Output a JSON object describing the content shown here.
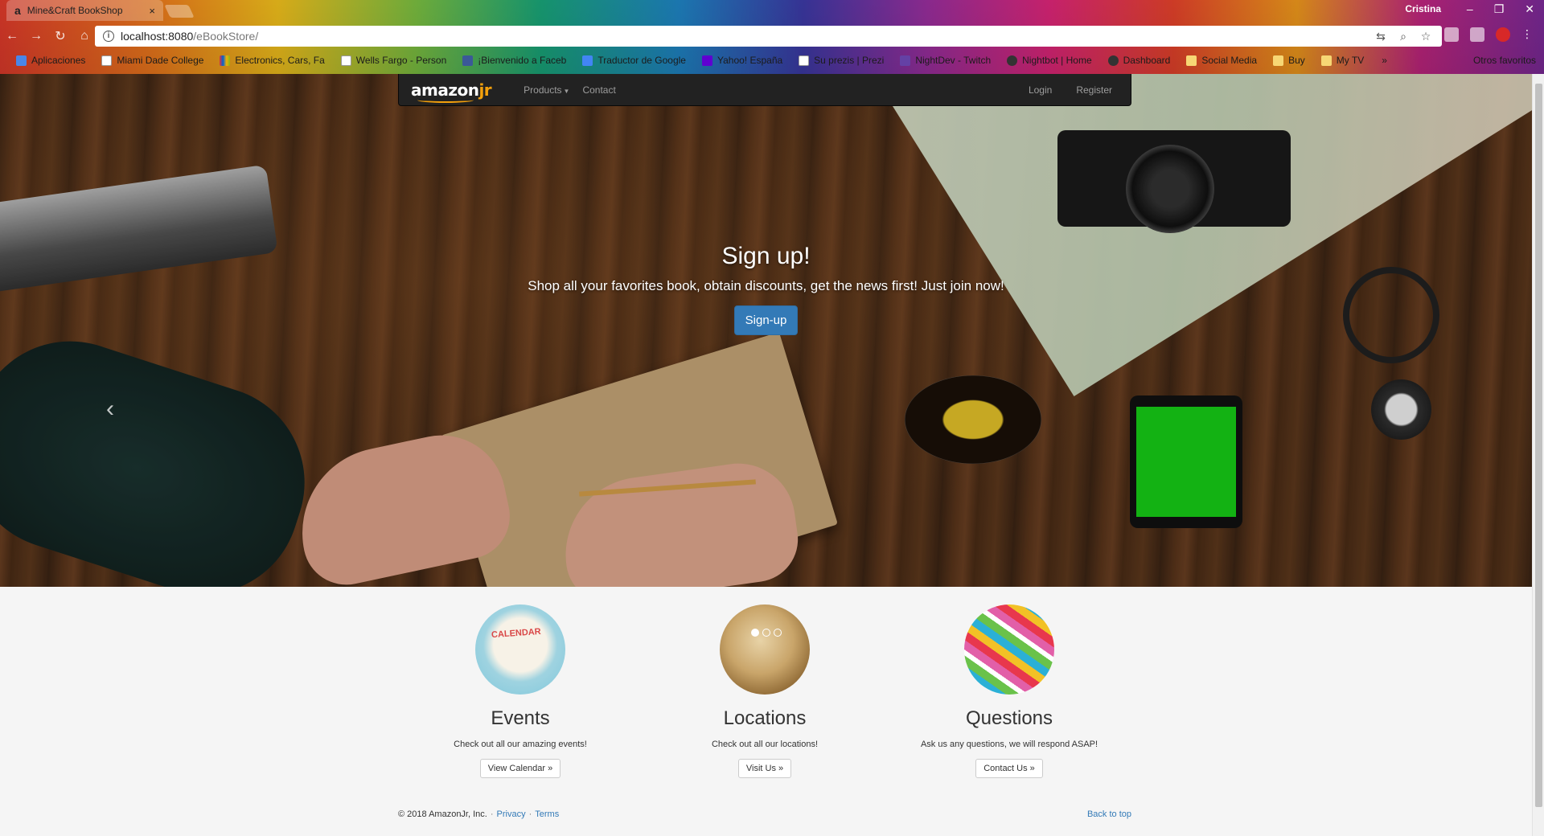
{
  "browser": {
    "tab_title": "Mine&Craft BookShop",
    "tab_favicon": "a",
    "tab_close": "×",
    "profile_name": "Cristina",
    "url_host": "localhost:8080",
    "url_path": "/eBookStore/",
    "bookmarks": [
      {
        "label": "Aplicaciones",
        "icon": "apps-icon",
        "color": "#4a86e8"
      },
      {
        "label": "Miami Dade College",
        "icon": "page-icon",
        "color": "#ffffff"
      },
      {
        "label": "Electronics, Cars, Fa",
        "icon": "ebay-icon",
        "color": "#e53238"
      },
      {
        "label": "Wells Fargo - Person",
        "icon": "page-icon",
        "color": "#ffffff"
      },
      {
        "label": "¡Bienvenido a Faceb",
        "icon": "facebook-icon",
        "color": "#3b5998"
      },
      {
        "label": "Traductor de Google",
        "icon": "translate-icon",
        "color": "#4285f4"
      },
      {
        "label": "Yahoo! España",
        "icon": "yahoo-icon",
        "color": "#5f01d1"
      },
      {
        "label": "Su prezis | Prezi",
        "icon": "page-icon",
        "color": "#ffffff"
      },
      {
        "label": "NightDev - Twitch",
        "icon": "twitch-icon",
        "color": "#6441a5"
      },
      {
        "label": "Nightbot | Home",
        "icon": "nightbot-icon",
        "color": "#333333"
      },
      {
        "label": "Dashboard",
        "icon": "dashboard-icon",
        "color": "#333333"
      },
      {
        "label": "Social Media",
        "icon": "folder-icon",
        "color": "#f7d774"
      },
      {
        "label": "Buy",
        "icon": "folder-icon",
        "color": "#f7d774"
      },
      {
        "label": "My TV",
        "icon": "folder-icon",
        "color": "#f7d774"
      }
    ],
    "bookmarks_more": "»",
    "other_bookmarks": "Otros favoritos"
  },
  "navbar": {
    "brand_main": "amazon",
    "brand_suffix": "jr",
    "products": "Products",
    "contact": "Contact",
    "login": "Login",
    "register": "Register"
  },
  "hero": {
    "title": "Sign up!",
    "text": "Shop all your favorites book, obtain discounts, get the news first! Just join now!",
    "button": "Sign-up",
    "prev_arrow": "‹",
    "slides": 3,
    "active_slide": 1
  },
  "features": [
    {
      "title": "Events",
      "text": "Check out all our amazing events!",
      "button": "View Calendar »",
      "image_label": "CALENDAR"
    },
    {
      "title": "Locations",
      "text": "Check out all our locations!",
      "button": "Visit Us »"
    },
    {
      "title": "Questions",
      "text": "Ask us any questions, we will respond ASAP!",
      "button": "Contact Us »"
    }
  ],
  "footer": {
    "copyright": "© 2018 AmazonJr, Inc.",
    "privacy": "Privacy",
    "terms": "Terms",
    "separator": "·",
    "back_to_top": "Back to top"
  },
  "colors": {
    "primary": "#337ab7",
    "navbar_bg": "#222222",
    "brand_accent": "#f3a00c"
  }
}
